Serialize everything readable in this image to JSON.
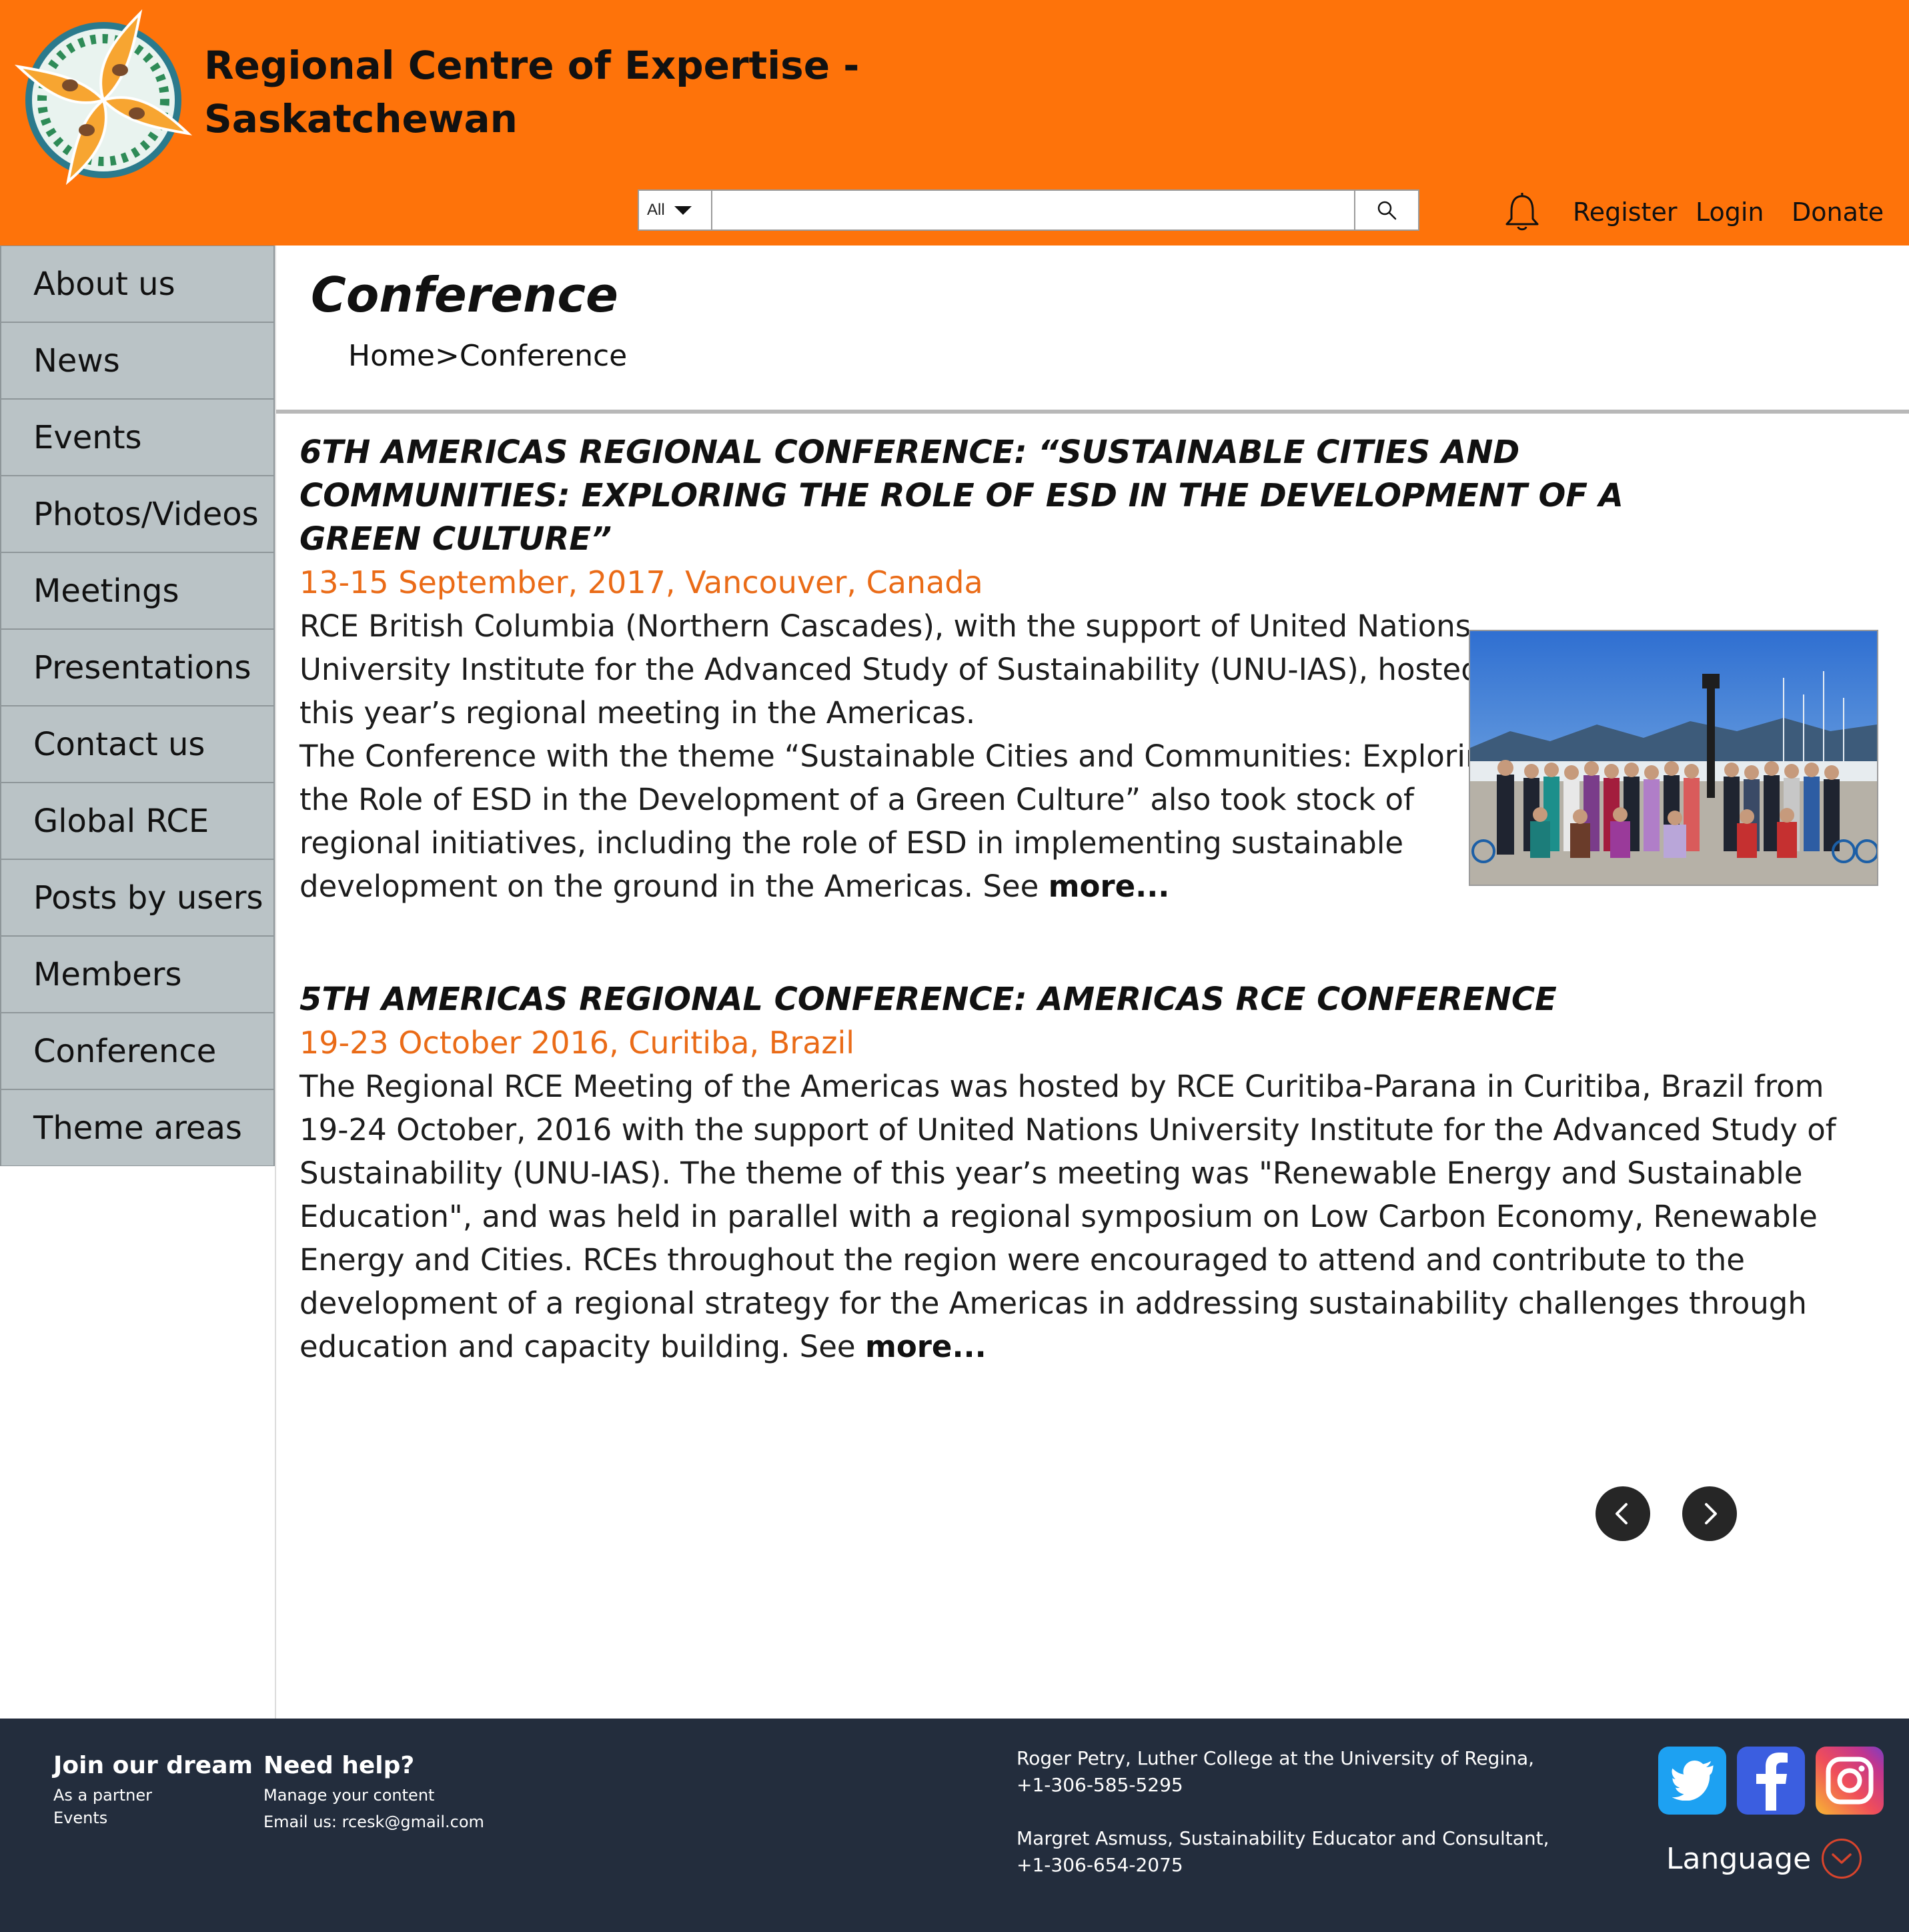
{
  "header": {
    "title_line1": "Regional Centre of Expertise -",
    "title_line2": "Saskatchewan",
    "search": {
      "scope": "All",
      "placeholder": ""
    },
    "nav": {
      "register": "Register",
      "login": "Login",
      "donate": "Donate"
    },
    "icons": {
      "logo": "rce-logo-icon",
      "search": "search-icon",
      "bell": "bell-icon",
      "caret": "caret-down-icon"
    }
  },
  "sidebar": {
    "items": [
      {
        "label": "About us"
      },
      {
        "label": "News"
      },
      {
        "label": "Events"
      },
      {
        "label": "Photos/Videos"
      },
      {
        "label": "Meetings"
      },
      {
        "label": "Presentations"
      },
      {
        "label": "Contact us"
      },
      {
        "label": "Global RCE"
      },
      {
        "label": "Posts by users"
      },
      {
        "label": "Members"
      },
      {
        "label": "Conference"
      },
      {
        "label": "Theme areas"
      }
    ]
  },
  "main": {
    "title": "Conference",
    "breadcrumb": {
      "home": "Home",
      "separator": ">",
      "current": "Conference"
    },
    "articles": [
      {
        "title_lines": [
          "6TH AMERICAS REGIONAL CONFERENCE: “SUSTAINABLE CITIES AND",
          "COMMUNITIES: EXPLORING THE ROLE OF ESD IN THE DEVELOPMENT OF A",
          "GREEN CULTURE”"
        ],
        "date": "13-15 September, 2017, Vancouver, Canada",
        "body_lines": [
          "RCE British Columbia (Northern Cascades), with the support of United Nations",
          "University Institute for the Advanced Study of Sustainability (UNU-IAS), hosted",
          "this year’s regional meeting in the Americas.",
          "The Conference with the theme “Sustainable Cities and Communities: Exploring",
          "the Role of ESD in the Development of a Green Culture” also took stock of",
          "regional initiatives, including the role of ESD in implementing sustainable",
          "development on the ground in the Americas. See "
        ],
        "more": "more..."
      },
      {
        "title_lines": [
          "5TH AMERICAS REGIONAL CONFERENCE: AMERICAS RCE CONFERENCE"
        ],
        "date": "19-23 October 2016, Curitiba, Brazil",
        "body_lines": [
          "The Regional RCE Meeting of the Americas was hosted by RCE Curitiba-Parana in Curitiba, Brazil from",
          "19-24 October, 2016 with the support of United Nations University Institute for the Advanced Study of",
          "Sustainability (UNU-IAS). The theme of this year’s meeting was \"Renewable Energy and Sustainable",
          "Education\", and was held in parallel with a regional symposium on Low Carbon Economy, Renewable",
          "Energy and Cities. RCEs throughout the region were encouraged to attend and contribute to the",
          "development of a regional strategy for the Americas in addressing sustainability challenges through",
          "education and capacity building. See "
        ],
        "more": "more..."
      }
    ],
    "pager": {
      "prev_icon": "chevron-left-icon",
      "next_icon": "chevron-right-icon"
    }
  },
  "footer": {
    "join": {
      "heading": "Join our dream",
      "links": [
        "As a partner",
        "Events"
      ]
    },
    "help": {
      "heading": "Need help?",
      "links": [
        "Manage your content",
        "Email us: rcesk@gmail.com"
      ]
    },
    "contacts": [
      {
        "line1": "Roger Petry, Luther College at the University of Regina,",
        "line2": "+1-306-585-5295"
      },
      {
        "line1": "Margret Asmuss, Sustainability Educator and Consultant,",
        "line2": "+1-306-654-2075"
      }
    ],
    "social": [
      "twitter-icon",
      "facebook-icon",
      "instagram-icon"
    ],
    "language_label": "Language"
  },
  "colors": {
    "header_bg": "#fe730a",
    "sidebar_bg": "#bac3c6",
    "date_accent": "#ea6b17",
    "footer_bg": "#232d3d"
  }
}
